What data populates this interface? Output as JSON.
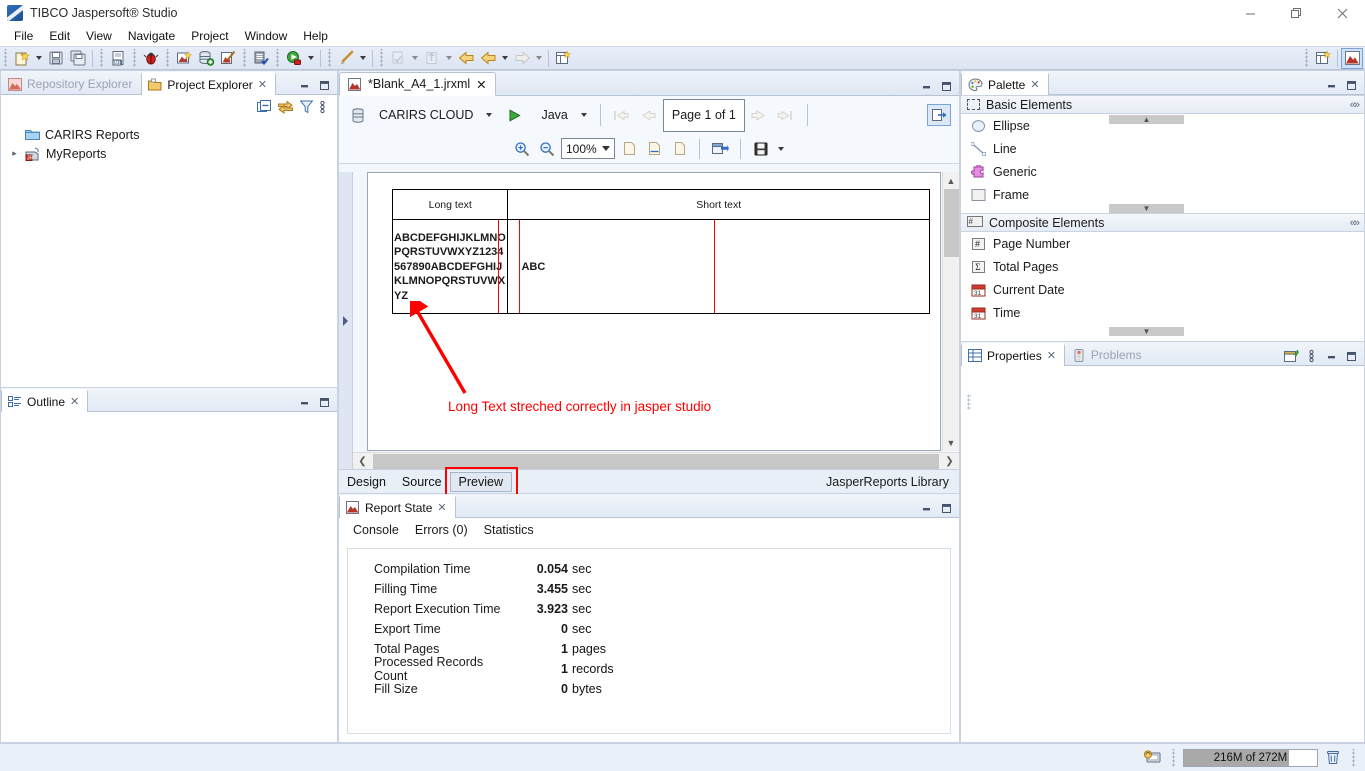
{
  "window": {
    "title": "TIBCO Jaspersoft® Studio",
    "app_icon": "jaspersoft-icon",
    "minimize": "—",
    "maximize": "❐",
    "close": "✕"
  },
  "menubar": {
    "items": [
      "File",
      "Edit",
      "View",
      "Navigate",
      "Project",
      "Window",
      "Help"
    ]
  },
  "toolbar": {
    "icons": [
      "new-report-icon",
      "save-icon",
      "save-all-icon",
      "new-jrxml-icon",
      "debug-icon",
      "new-report-wizard-icon",
      "new-datasource-icon",
      "new-jrxml-wizard-icon",
      "compile-report-icon",
      "run-icon",
      "edit-icon",
      "validate-icon",
      "forward-nav-icon",
      "back-arrow-icon",
      "forward-arrow-icon",
      "open-perspective-icon",
      "jaspersoft-perspective-icon"
    ]
  },
  "left": {
    "explorer": {
      "tabs": [
        {
          "label": "Repository Explorer",
          "icon": "repository-icon",
          "active": false
        },
        {
          "label": "Project Explorer",
          "icon": "project-icon",
          "active": true
        }
      ],
      "toolbar_icons": [
        "collapse-all-icon",
        "link-with-editor-icon",
        "filter-icon",
        "view-menu-icon"
      ],
      "minimize": "—",
      "maximize": "❐",
      "tree": [
        {
          "label": "CARIRS Reports",
          "icon": "folder-icon",
          "expandable": false
        },
        {
          "label": "MyReports",
          "icon": "jasper-project-icon",
          "expandable": true
        }
      ]
    },
    "outline": {
      "tab_label": "Outline",
      "icon": "outline-icon",
      "minimize": "—",
      "maximize": "❐"
    }
  },
  "editor": {
    "tab_label": "*Blank_A4_1.jrxml",
    "tab_icon": "jrxml-file-icon",
    "minimize": "—",
    "maximize": "❐",
    "datasource": "CARIRS CLOUD",
    "datasource_icon": "datasource-icon",
    "run_icon": "run-report-icon",
    "language": "Java",
    "page_indicator": "Page 1 of 1",
    "nav_icons": [
      "first-page-icon",
      "prev-page-icon",
      "next-page-icon",
      "last-page-icon"
    ],
    "export_icon": "export-icon",
    "zoom_in_icon": "zoom-in-icon",
    "zoom_out_icon": "zoom-out-icon",
    "zoom_level": "100%",
    "fit_icons": [
      "actual-size-icon",
      "fit-width-icon",
      "fit-page-icon"
    ],
    "save_icon": "save-output-icon",
    "bottom_tabs": [
      {
        "label": "Design",
        "selected": false
      },
      {
        "label": "Source",
        "selected": false
      },
      {
        "label": "Preview",
        "selected": true
      }
    ],
    "library_label": "JasperReports Library",
    "preview": {
      "columns": [
        "Long text",
        "Short text"
      ],
      "rows": [
        {
          "long_text": "ABCDEFGHIJKLMNOPQRSTUVWXYZ1234567890ABCDEFGHIJKLMNOPQRSTUVWXYZ",
          "short_text": "ABC"
        }
      ],
      "annotation": "Long Text streched correctly in jasper studio",
      "annotation_color": "#ff0000"
    }
  },
  "report_state": {
    "tab_label": "Report State",
    "tab_icon": "report-state-icon",
    "minimize": "—",
    "maximize": "❐",
    "tabs": [
      "Console",
      "Errors (0)",
      "Statistics"
    ],
    "active_tab": "Statistics",
    "statistics": [
      {
        "label": "Compilation Time",
        "value": "0.054",
        "unit": "sec"
      },
      {
        "label": "Filling Time",
        "value": "3.455",
        "unit": "sec"
      },
      {
        "label": "Report Execution Time",
        "value": "3.923",
        "unit": "sec"
      },
      {
        "label": "Export Time",
        "value": "0",
        "unit": "sec"
      },
      {
        "label": "Total Pages",
        "value": "1",
        "unit": "pages"
      },
      {
        "label": "Processed Records Count",
        "value": "1",
        "unit": "records"
      },
      {
        "label": "Fill Size",
        "value": "0",
        "unit": "bytes"
      }
    ]
  },
  "palette": {
    "tab_label": "Palette",
    "tab_icon": "palette-icon",
    "minimize": "—",
    "maximize": "❐",
    "sections": [
      {
        "title": "Basic Elements",
        "icon": "basic-elements-icon",
        "items": [
          {
            "label": "Ellipse",
            "icon": "ellipse-icon"
          },
          {
            "label": "Line",
            "icon": "line-icon"
          },
          {
            "label": "Generic",
            "icon": "generic-icon"
          },
          {
            "label": "Frame",
            "icon": "frame-icon"
          }
        ]
      },
      {
        "title": "Composite Elements",
        "icon": "composite-elements-icon",
        "items": [
          {
            "label": "Page Number",
            "icon": "page-number-icon"
          },
          {
            "label": "Total Pages",
            "icon": "total-pages-icon"
          },
          {
            "label": "Current Date",
            "icon": "current-date-icon"
          },
          {
            "label": "Time",
            "icon": "time-icon"
          }
        ]
      }
    ]
  },
  "properties": {
    "tabs": [
      {
        "label": "Properties",
        "icon": "properties-icon",
        "active": true
      },
      {
        "label": "Problems",
        "icon": "problems-icon",
        "active": false
      }
    ],
    "toolbar_icons": [
      "new-tab-icon",
      "view-menu-icon"
    ],
    "minimize": "—",
    "maximize": "❐"
  },
  "statusbar": {
    "icons": [
      "remote-system-icon",
      "trash-icon"
    ],
    "heap": "216M of 272M",
    "heap_percent": 79
  },
  "colors": {
    "accent": "#3a6fb0",
    "annotation_red": "#ff0000",
    "panel_bg": "#f3f6fb",
    "tab_active_bg": "#ffffff"
  }
}
